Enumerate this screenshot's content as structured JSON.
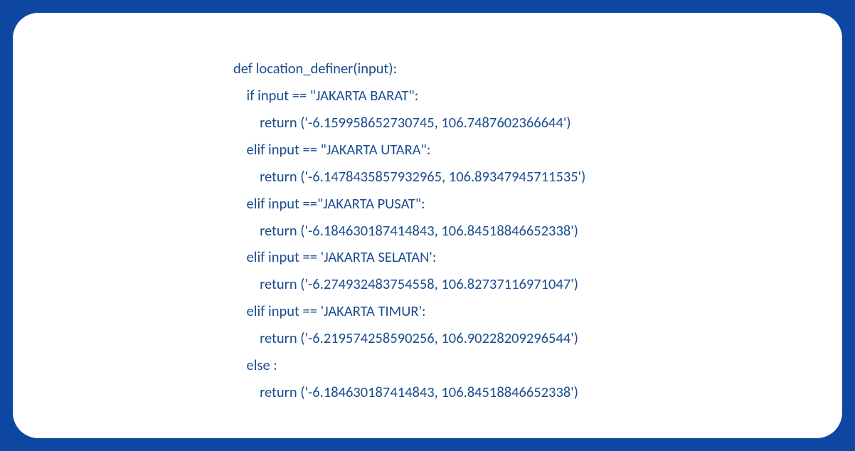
{
  "code": {
    "lines": [
      "def location_definer(input):",
      "    if input == \"JAKARTA BARAT\":",
      "        return ('-6.159958652730745, 106.7487602366644')",
      "    elif input == \"JAKARTA UTARA\":",
      "        return ('-6.1478435857932965, 106.89347945711535')",
      "    elif input ==\"JAKARTA PUSAT\":",
      "        return ('-6.184630187414843, 106.84518846652338')",
      "    elif input == 'JAKARTA SELATAN':",
      "        return ('-6.274932483754558, 106.82737116971047')",
      "    elif input == 'JAKARTA TIMUR':",
      "        return ('-6.219574258590256, 106.90228209296544')",
      "    else :",
      "        return ('-6.184630187414843, 106.84518846652338')"
    ]
  }
}
